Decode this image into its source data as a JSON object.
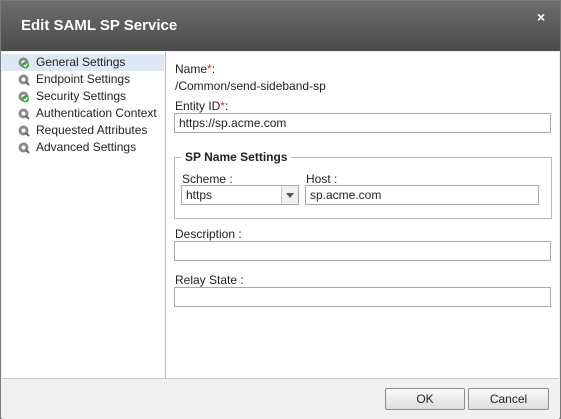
{
  "dialog": {
    "title": "Edit SAML SP Service",
    "close_label": "×"
  },
  "sidebar": {
    "items": [
      {
        "label": "General Settings",
        "icon": "check-gear-icon",
        "selected": true
      },
      {
        "label": "Endpoint Settings",
        "icon": "gear-icon"
      },
      {
        "label": "Security Settings",
        "icon": "check-gear-icon"
      },
      {
        "label": "Authentication Context",
        "icon": "gear-icon"
      },
      {
        "label": "Requested Attributes",
        "icon": "gear-icon"
      },
      {
        "label": "Advanced Settings",
        "icon": "gear-icon"
      }
    ]
  },
  "form": {
    "name_label": "Name",
    "name_value": "/Common/send-sideband-sp",
    "entity_id_label": "Entity ID",
    "entity_id_value": "https://sp.acme.com",
    "required_mark": "*",
    "colon": ":",
    "sp_name_settings": {
      "legend": "SP Name Settings",
      "scheme_label": "Scheme :",
      "scheme_value": "https",
      "host_label": "Host :",
      "host_value": "sp.acme.com"
    },
    "description_label": "Description :",
    "description_value": "",
    "relay_state_label": "Relay State :",
    "relay_state_value": ""
  },
  "footer": {
    "ok_label": "OK",
    "cancel_label": "Cancel"
  },
  "colors": {
    "titlebar": "#5a5a5a",
    "selected_row": "#dde7f6",
    "required": "#c0392b"
  }
}
